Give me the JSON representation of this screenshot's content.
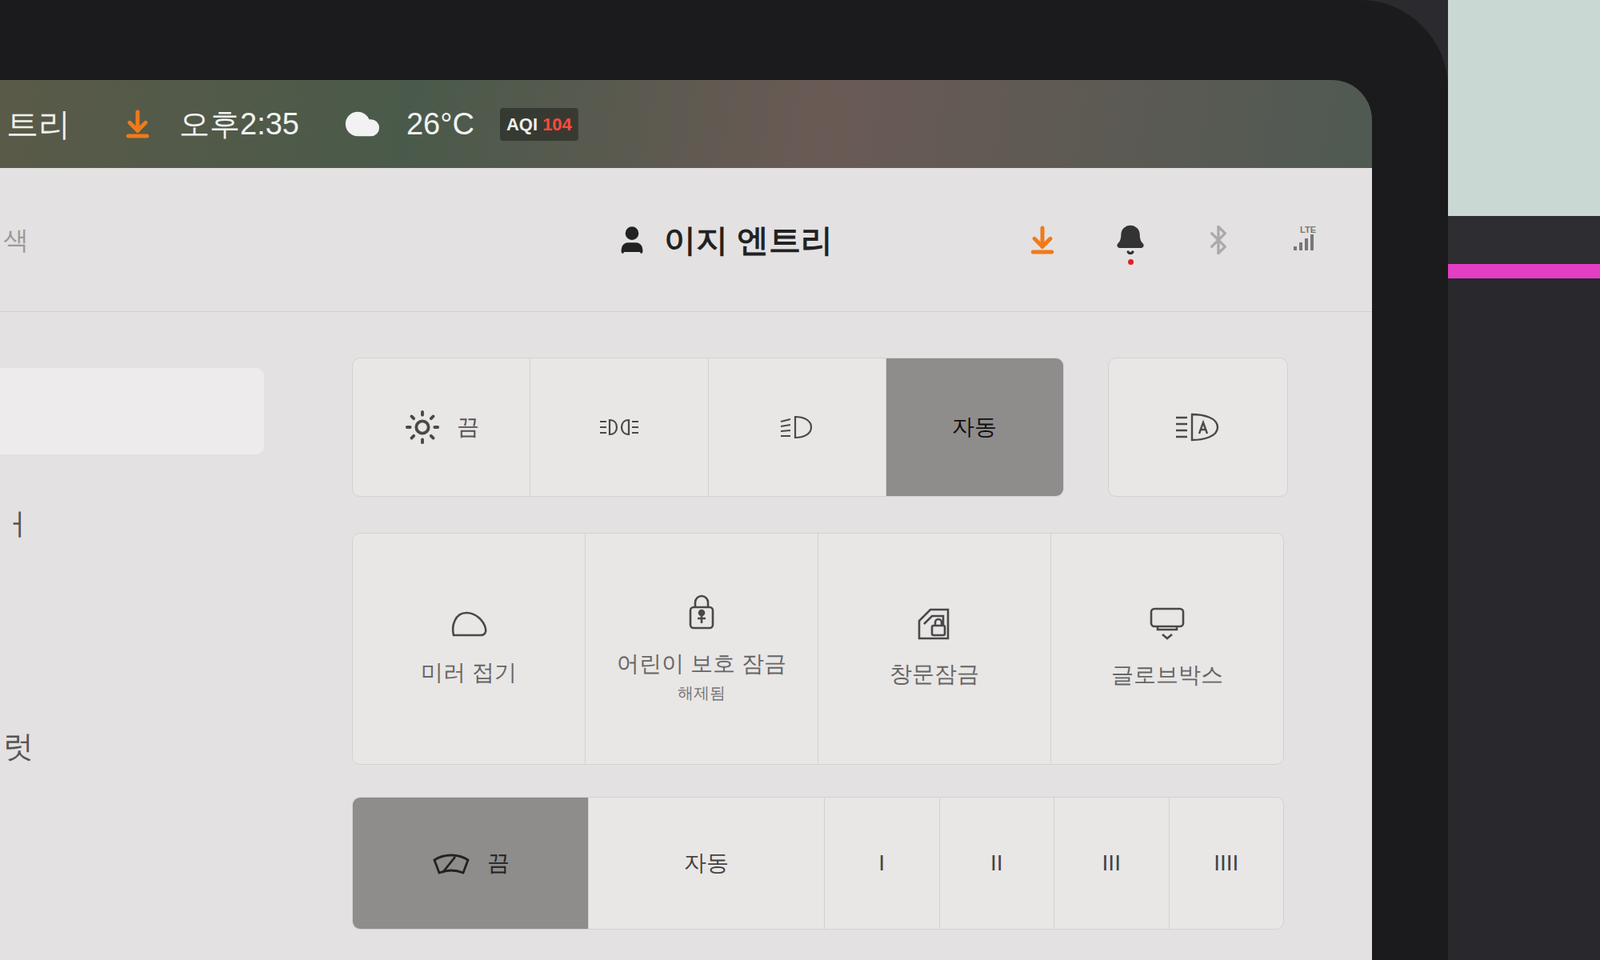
{
  "status_bar": {
    "left_partial": "트리",
    "download_pending": true,
    "time": "오후2:35",
    "temperature": "26°C",
    "aqi_label": "AQI",
    "aqi_value": "104"
  },
  "header": {
    "left_partial": "색",
    "profile": "이지 엔트리",
    "download_pending": true,
    "notification_dot": true,
    "bluetooth_on": false,
    "network": "LTE",
    "signal_level": 1
  },
  "sidebar": {
    "search_placeholder": "",
    "items": [
      {
        "label": "ㅓ"
      },
      {
        "label": "럿"
      }
    ]
  },
  "lights": [
    {
      "kind": "sun-label",
      "label": "끔",
      "selected": false
    },
    {
      "kind": "parking",
      "label": "",
      "selected": false
    },
    {
      "kind": "low-beam",
      "label": "",
      "selected": false
    },
    {
      "kind": "text",
      "label": "자동",
      "selected": true
    }
  ],
  "auto_high_beam": {
    "on": false
  },
  "controls": [
    {
      "kind": "mirror",
      "label": "미러 접기",
      "status": ""
    },
    {
      "kind": "child-lock",
      "label": "어린이 보호 잠금",
      "status": "해제됨"
    },
    {
      "kind": "window-lock",
      "label": "창문잠금",
      "status": ""
    },
    {
      "kind": "glovebox",
      "label": "글로브박스",
      "status": ""
    }
  ],
  "wipers": [
    {
      "kind": "wiper-label",
      "label": "끔",
      "selected": true
    },
    {
      "kind": "text",
      "label": "자동",
      "selected": false
    },
    {
      "kind": "text",
      "label": "I",
      "selected": false
    },
    {
      "kind": "text",
      "label": "II",
      "selected": false
    },
    {
      "kind": "text",
      "label": "III",
      "selected": false
    },
    {
      "kind": "text",
      "label": "IIII",
      "selected": false
    }
  ]
}
